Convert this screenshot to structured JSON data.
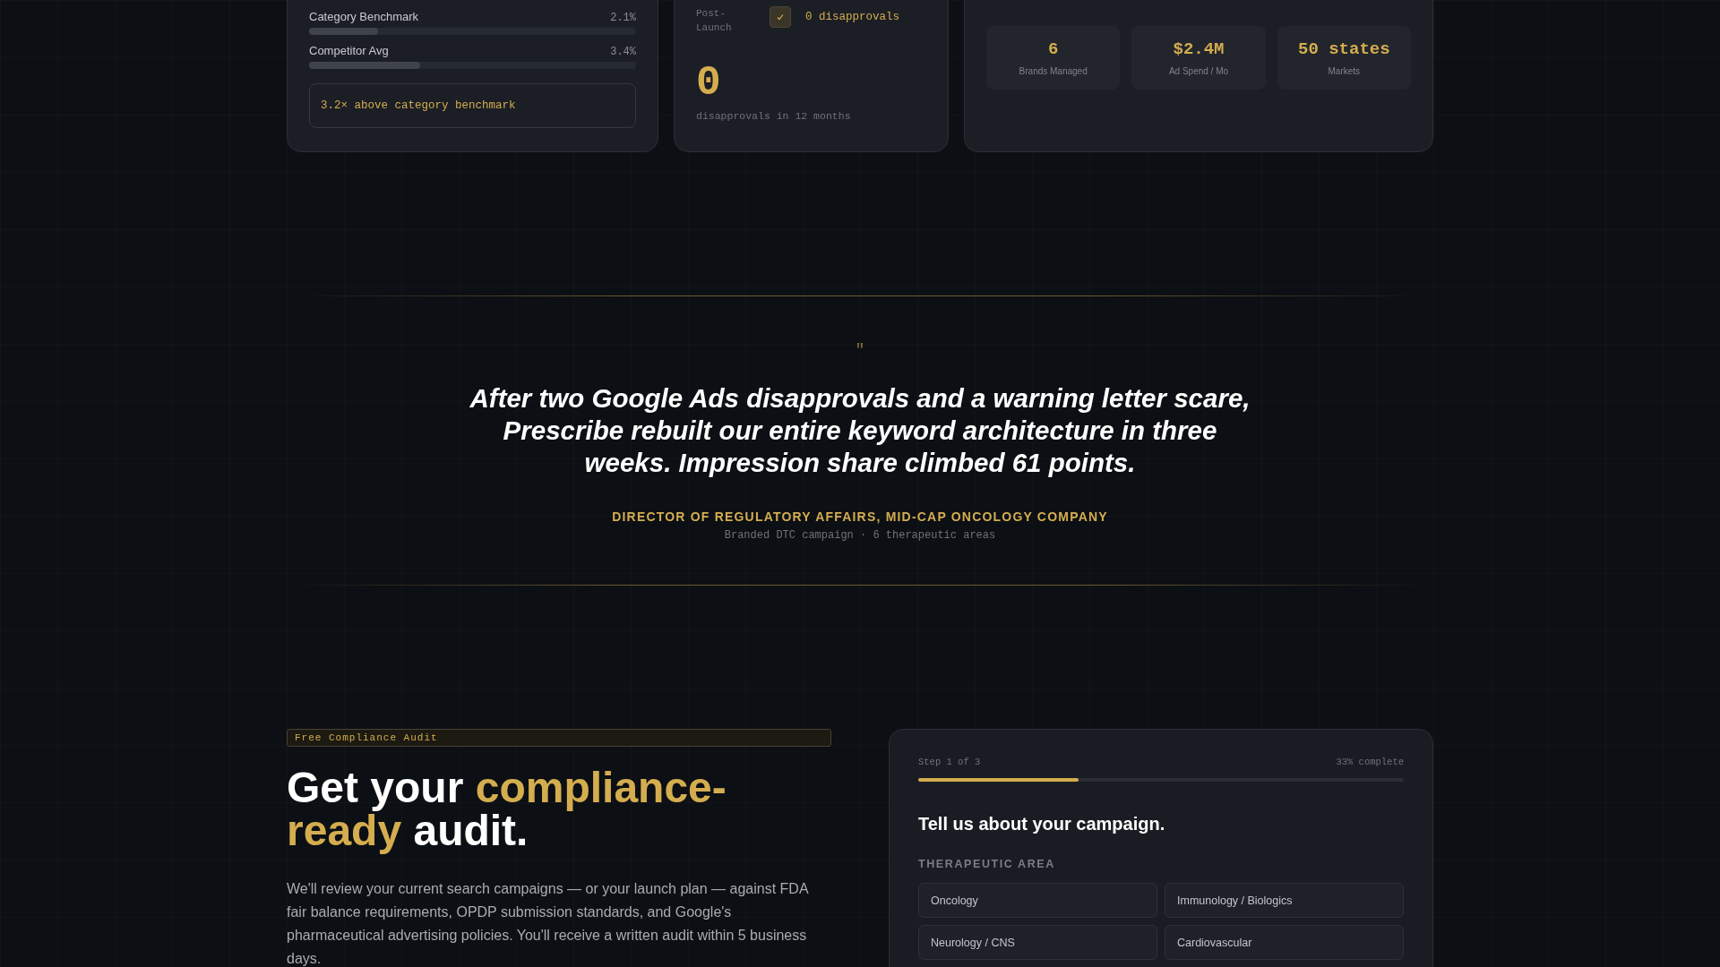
{
  "benchmark_card": {
    "bars": [
      {
        "label": "Category Benchmark",
        "reading": "2.1%",
        "level": 0.21
      },
      {
        "label": "Competitor Avg",
        "reading": "3.4%",
        "level": 0.34
      }
    ],
    "callout": "3.2× above category benchmark"
  },
  "disapprovals_card": {
    "stage": "Post-Launch",
    "checked": true,
    "status": "0 disapprovals",
    "count": "0",
    "caption": "disapprovals in 12 months"
  },
  "client_card": {
    "stats": [
      {
        "value": "6",
        "label": "Brands Managed"
      },
      {
        "value": "$2.4M",
        "label": "Ad Spend / Mo"
      },
      {
        "value": "50 states",
        "label": "Markets"
      }
    ]
  },
  "testimonial": {
    "mark": "\"",
    "quote": "After two Google Ads disapprovals and a warning letter scare, Prescribe rebuilt our entire keyword architecture in three weeks. Impression share climbed 61 points.",
    "author": "DIRECTOR OF REGULATORY AFFAIRS, MID-CAP ONCOLOGY COMPANY",
    "context": "Branded DTC campaign · 6 therapeutic areas"
  },
  "audit": {
    "badge": "Free Compliance Audit",
    "heading": [
      {
        "text": "Get your ",
        "highlight": false
      },
      {
        "text": "compliance-ready",
        "highlight": true
      },
      {
        "text": " audit.",
        "highlight": false
      }
    ],
    "description": "We'll review your current search campaigns — or your launch plan — against FDA fair balance requirements, OPDP submission standards, and Google's pharmaceutical advertising policies. You'll receive a written audit within 5 business days."
  },
  "form": {
    "step": "Step 1 of 3",
    "progress": "33% complete",
    "level": 0.33,
    "title": "Tell us about your campaign.",
    "field_label": "THERAPEUTIC AREA",
    "options": [
      {
        "label": "Oncology"
      },
      {
        "label": "Immunology / Biologics"
      },
      {
        "label": "Neurology / CNS"
      },
      {
        "label": "Cardiovascular"
      }
    ]
  }
}
